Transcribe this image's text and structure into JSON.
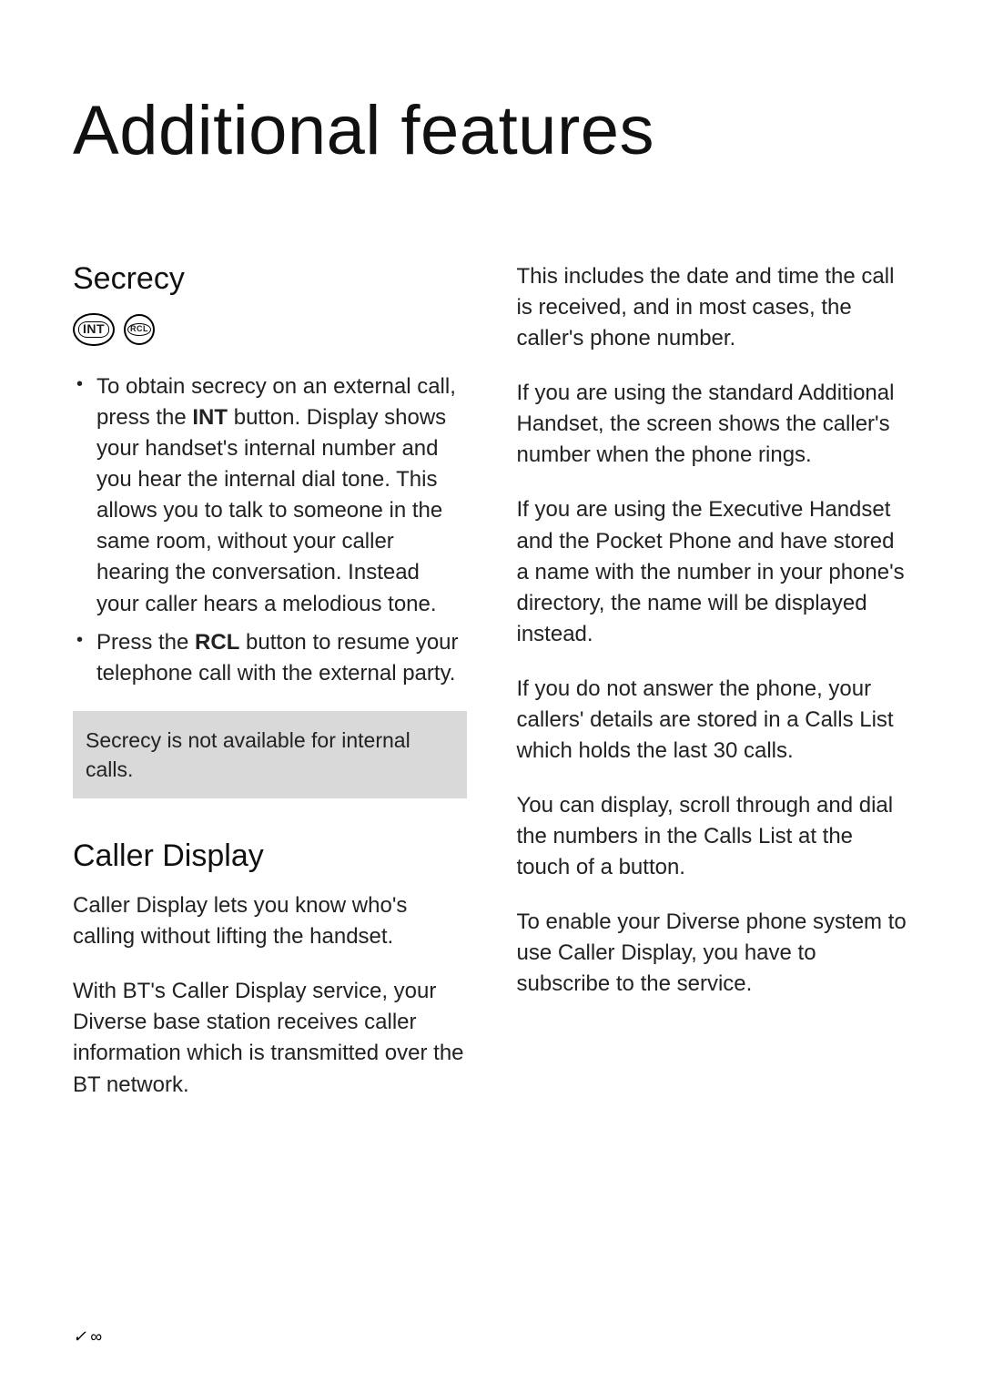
{
  "title": "Additional features",
  "left": {
    "secrecy": {
      "heading": "Secrecy",
      "icons": {
        "int": "INT",
        "rcl": "RCL"
      },
      "bullets": [
        {
          "pre": "To obtain secrecy on an external call, press the ",
          "bold1": "INT",
          "mid": " button. Display shows your handset's internal number and you hear the internal dial tone. This allows you to talk to someone in the same room, without your caller hearing the conversation. Instead your caller hears a melodious tone."
        },
        {
          "pre": "Press the ",
          "bold1": "RCL",
          "mid": " button to resume your telephone call with the external party."
        }
      ],
      "note": "Secrecy is not available for internal calls."
    },
    "caller_display": {
      "heading": "Caller Display",
      "intro": "Caller Display lets you know who's calling without lifting the handset.",
      "p1": "With BT's Caller Display service, your Diverse base station receives caller information which is transmitted over the BT network."
    }
  },
  "right": {
    "p1": "This includes the date and time the call is received, and in most cases, the caller's phone number.",
    "p2": "If you are using the standard Additional Handset, the screen shows the caller's number when the phone rings.",
    "p3": "If you are using the Executive Handset and the Pocket Phone and have stored a name with the number in your phone's directory, the name will be displayed instead.",
    "p4": "If you do not answer the phone, your callers' details are stored in a Calls List which holds the last 30 calls.",
    "p5": "You can display, scroll through and dial the numbers in the Calls List at the touch of a button.",
    "p6": "To enable your Diverse phone system to use Caller Display, you have to subscribe to the service."
  },
  "page_number": "✓∞"
}
